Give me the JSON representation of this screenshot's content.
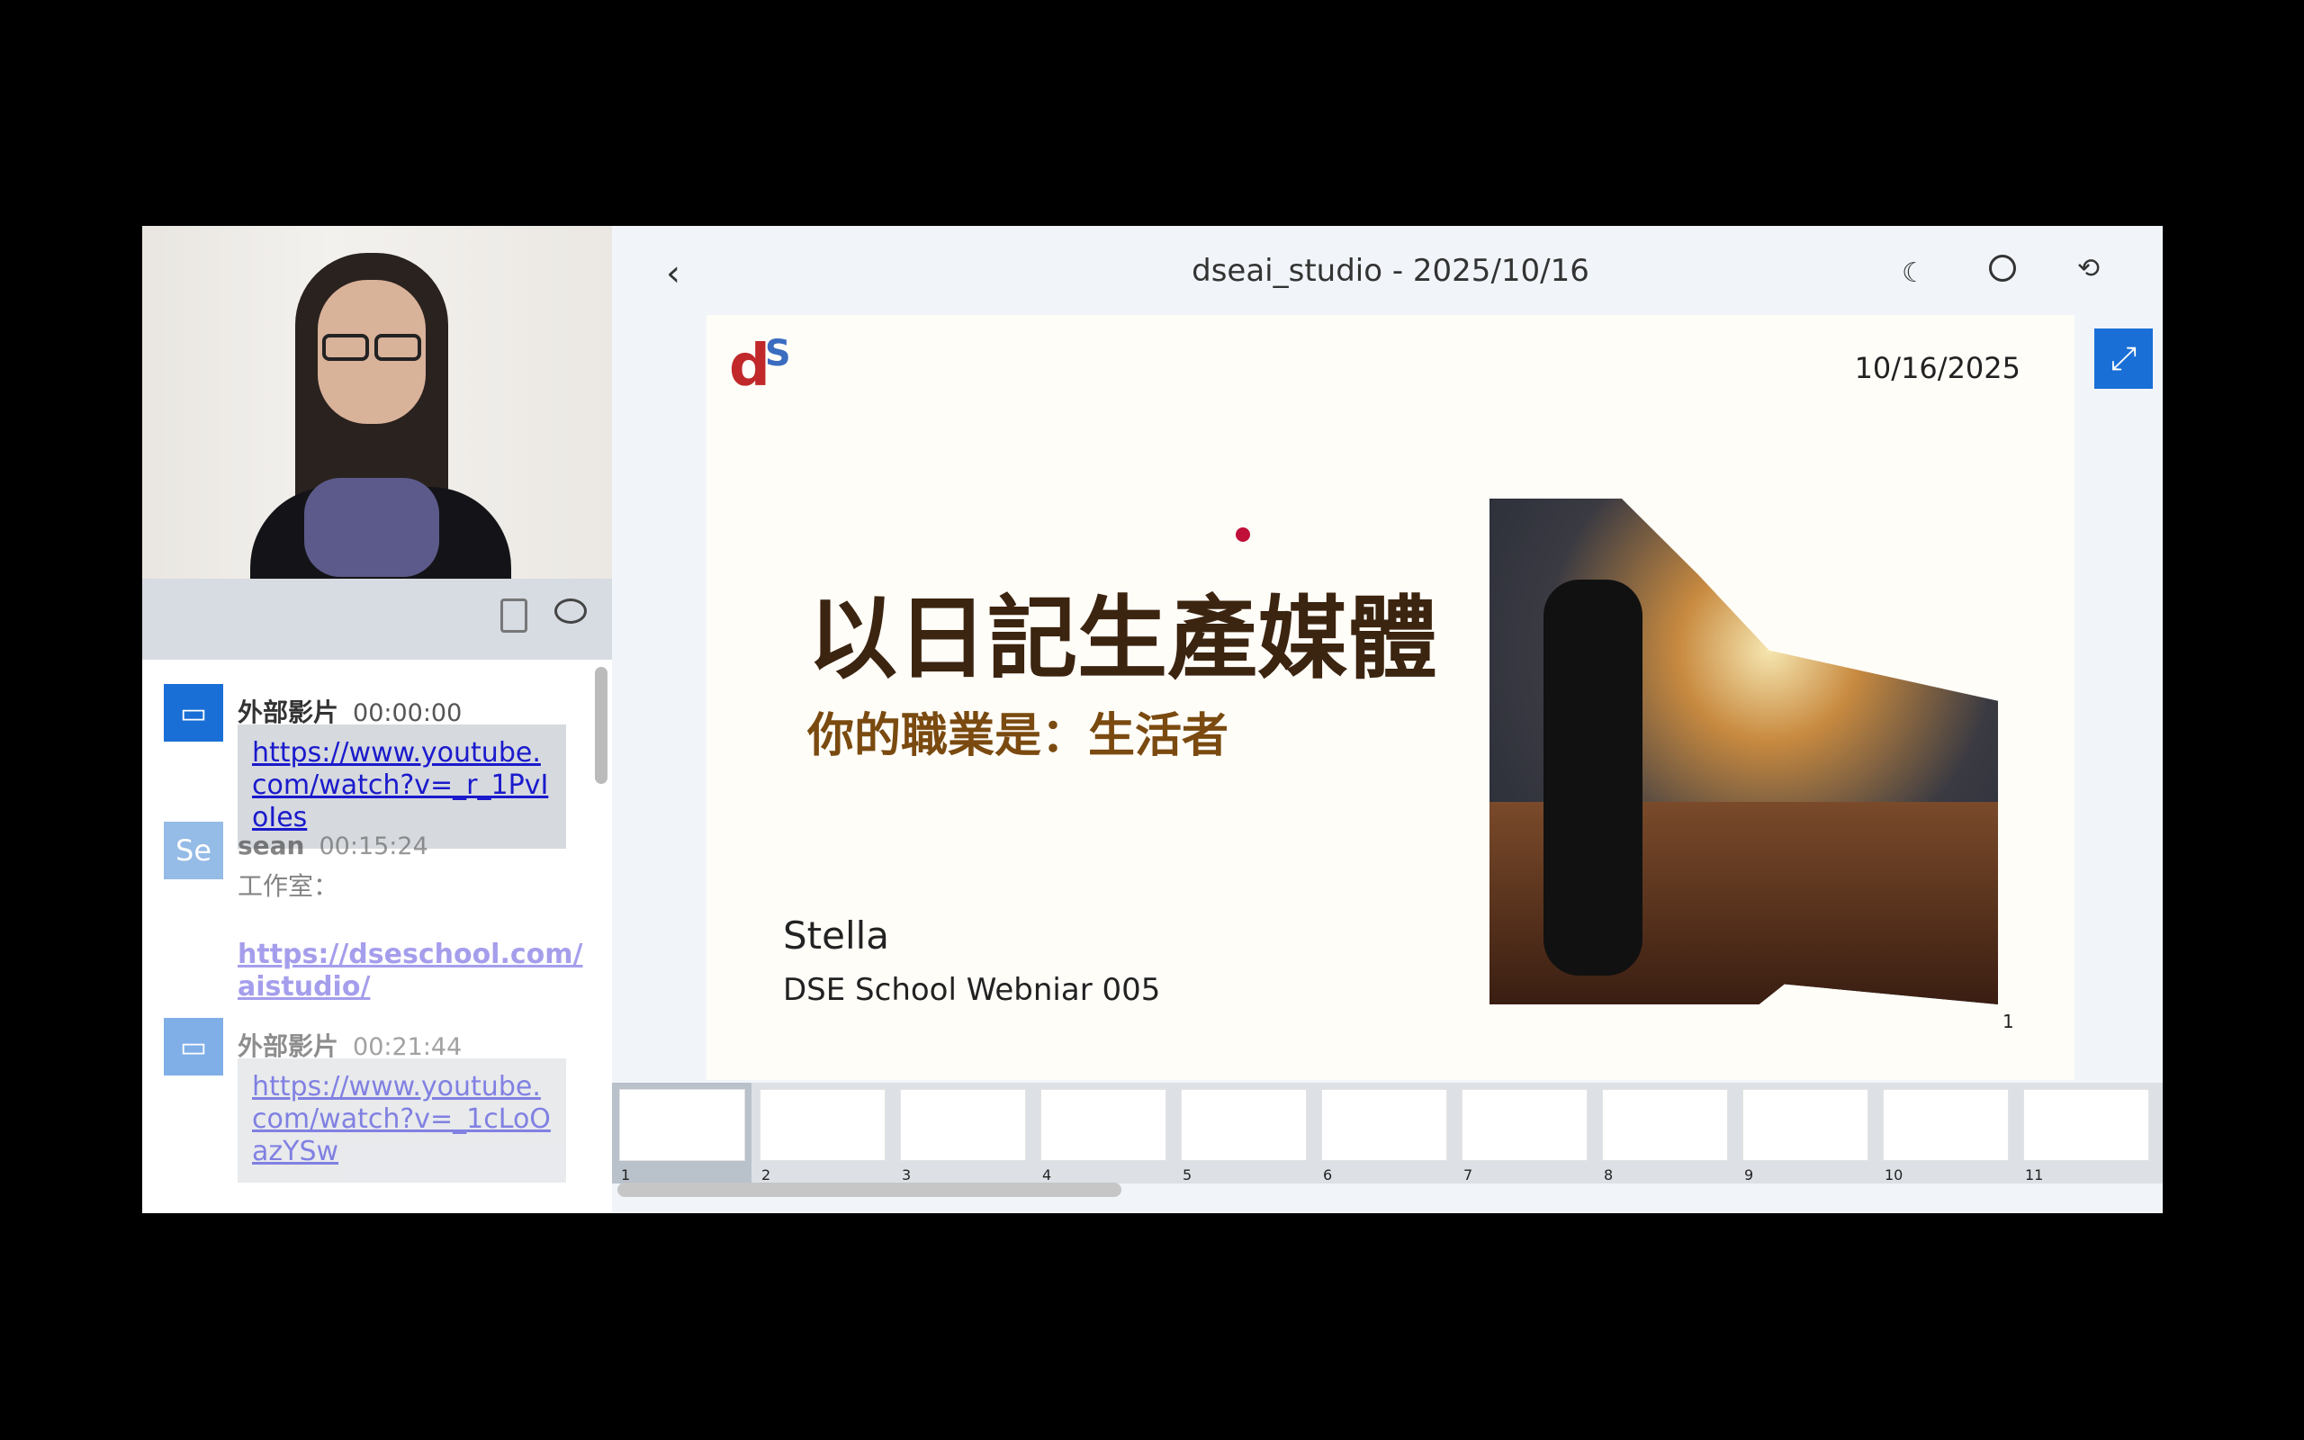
{
  "header": {
    "title": "dseai_studio - 2025/10/16"
  },
  "slide": {
    "logo": "dSE",
    "date": "10/16/2025",
    "title": "以日記生產媒體",
    "subtitle": "你的職業是：生活者",
    "presenter": "Stella",
    "event": "DSE School Webniar 005",
    "page": "1"
  },
  "chat": [
    {
      "avatar": "video-icon",
      "name": "外部影片",
      "time": "00:00:00",
      "text": "https://www.youtube.com/watch?v=_r_1PvIoIes"
    },
    {
      "avatar": "Se",
      "name": "sean",
      "time": "00:15:24",
      "text": "工作室：",
      "link": "https://dseschool.com/aistudio/"
    },
    {
      "avatar": "video-icon",
      "name": "外部影片",
      "time": "00:21:44",
      "text": "https://www.youtube.com/watch?v=_1cLoOazYSw"
    }
  ],
  "thumbnails": [
    "1",
    "2",
    "3",
    "4",
    "5",
    "6",
    "7",
    "8",
    "9",
    "10",
    "11"
  ],
  "colors": {
    "accent": "#1a6fd6",
    "title": "#3b2410",
    "subtitle": "#7a4a10"
  }
}
